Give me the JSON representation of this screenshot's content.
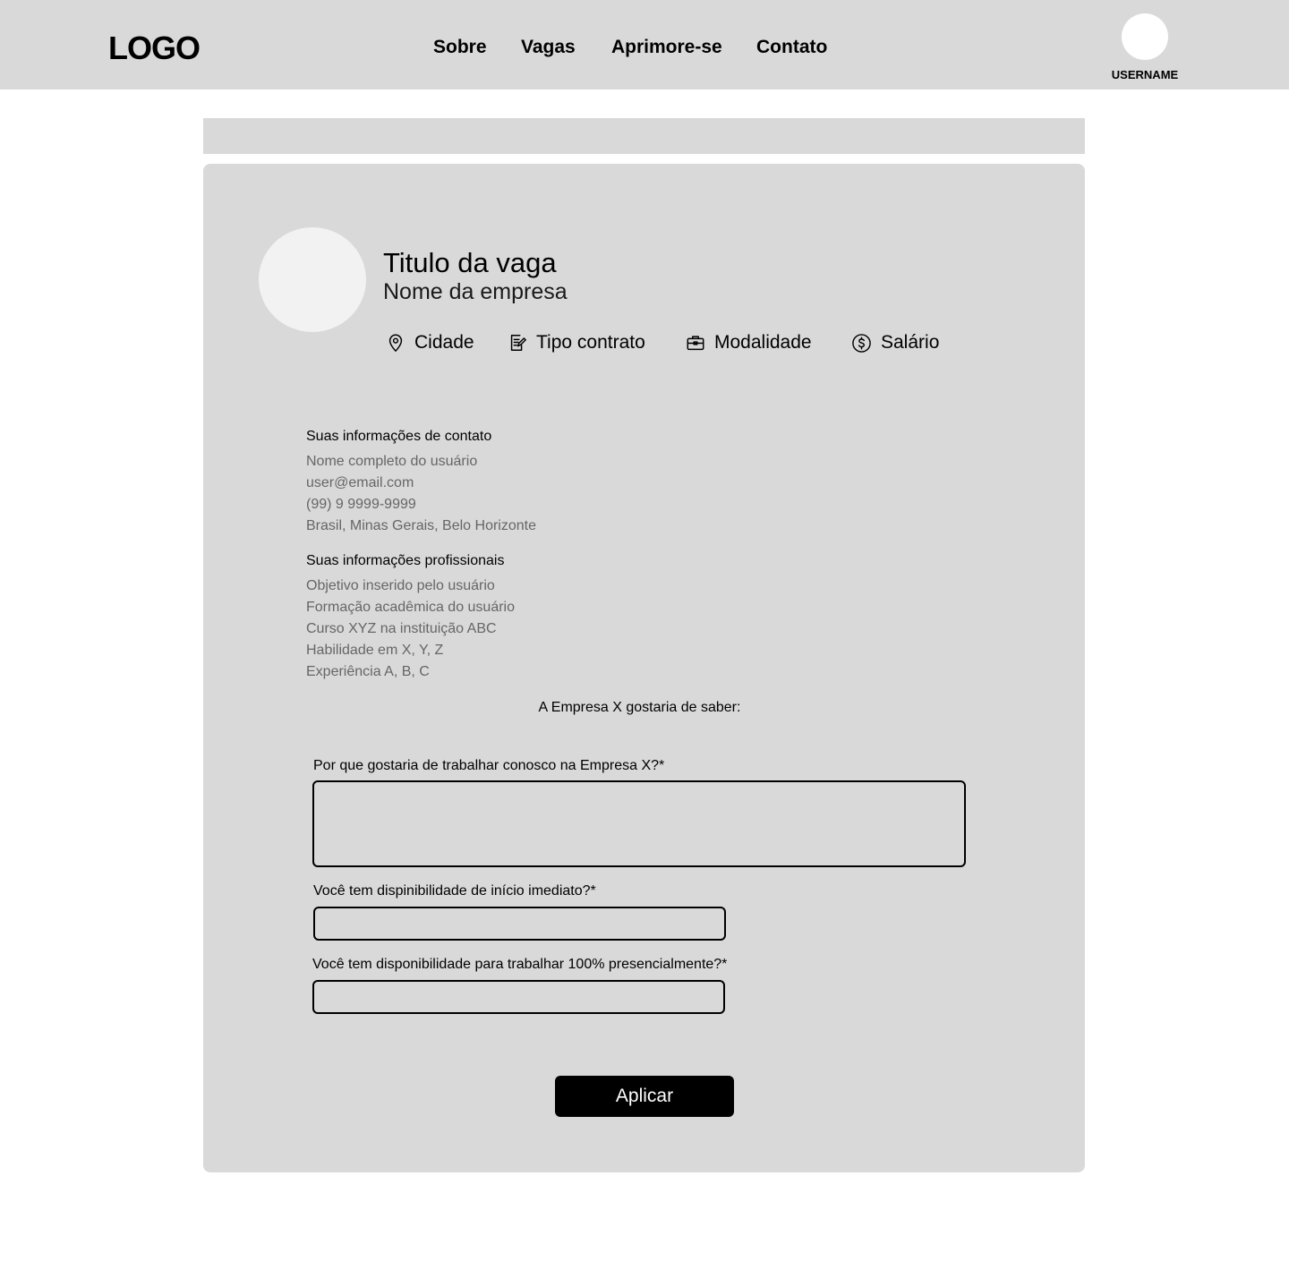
{
  "header": {
    "logo": "LOGO",
    "nav": [
      "Sobre",
      "Vagas",
      "Aprimore-se",
      "Contato"
    ],
    "username": "USERNAME"
  },
  "job": {
    "title": "Titulo da vaga",
    "company": "Nome da empresa",
    "meta": {
      "city": "Cidade",
      "contract": "Tipo contrato",
      "modality": "Modalidade",
      "salary": "Salário"
    }
  },
  "contact": {
    "heading": "Suas informações de contato",
    "lines": [
      "Nome completo do usuário",
      "user@email.com",
      "(99) 9 9999-9999",
      "Brasil, Minas Gerais, Belo Horizonte"
    ]
  },
  "professional": {
    "heading": "Suas informações profissionais",
    "lines": [
      "Objetivo inserido pelo usuário",
      "Formação acadêmica do usuário",
      "Curso XYZ na instituição ABC",
      "Habilidade em X, Y, Z",
      "Experiência A, B, C"
    ]
  },
  "questions": {
    "intro": "A Empresa X gostaria de saber:",
    "q1": "Por que gostaria de trabalhar conosco na Empresa X?*",
    "q2": "Você tem dispinibilidade de início imediato?*",
    "q3": "Você tem disponibilidade para trabalhar 100% presencialmente?*"
  },
  "apply_label": "Aplicar"
}
